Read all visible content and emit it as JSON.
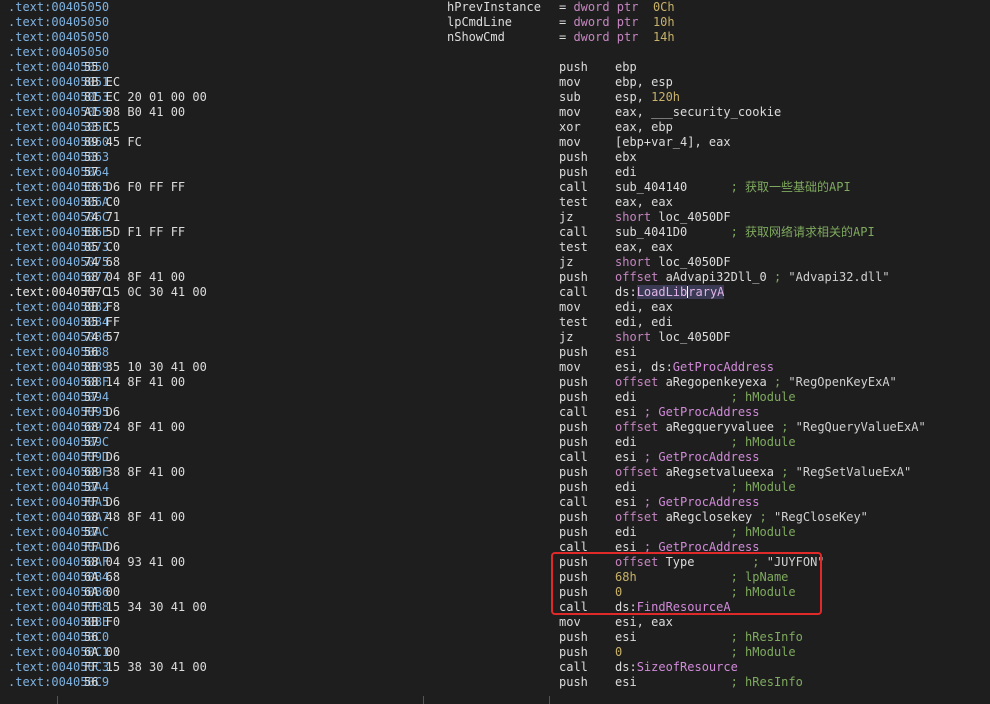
{
  "rows": [
    {
      "addr": ".text:00405050",
      "bytes": "",
      "arg_name": "hPrevInstance",
      "arg_def": [
        {
          "t": "= "
        },
        {
          "t": "dword ptr",
          "c": "kw"
        },
        {
          "t": "  "
        },
        {
          "t": "0Ch",
          "c": "num"
        }
      ]
    },
    {
      "addr": ".text:00405050",
      "bytes": "",
      "arg_name": "lpCmdLine",
      "arg_def": [
        {
          "t": "= "
        },
        {
          "t": "dword ptr",
          "c": "kw"
        },
        {
          "t": "  "
        },
        {
          "t": "10h",
          "c": "num"
        }
      ]
    },
    {
      "addr": ".text:00405050",
      "bytes": "",
      "arg_name": "nShowCmd",
      "arg_def": [
        {
          "t": "= "
        },
        {
          "t": "dword ptr",
          "c": "kw"
        },
        {
          "t": "  "
        },
        {
          "t": "14h",
          "c": "num"
        }
      ]
    },
    {
      "addr": ".text:00405050",
      "bytes": ""
    },
    {
      "addr": ".text:00405050",
      "bytes": "55",
      "mn": "push",
      "ops": [
        {
          "t": "ebp"
        }
      ]
    },
    {
      "addr": ".text:00405051",
      "bytes": "8B EC",
      "mn": "mov",
      "ops": [
        {
          "t": "ebp, esp"
        }
      ]
    },
    {
      "addr": ".text:00405053",
      "bytes": "81 EC 20 01 00 00",
      "mn": "sub",
      "ops": [
        {
          "t": "esp, "
        },
        {
          "t": "120h",
          "c": "num"
        }
      ]
    },
    {
      "addr": ".text:00405059",
      "bytes": "A1 08 B0 41 00",
      "mn": "mov",
      "ops": [
        {
          "t": "eax, ___security_cookie"
        }
      ]
    },
    {
      "addr": ".text:0040505E",
      "bytes": "33 C5",
      "mn": "xor",
      "ops": [
        {
          "t": "eax, ebp"
        }
      ]
    },
    {
      "addr": ".text:00405060",
      "bytes": "89 45 FC",
      "mn": "mov",
      "ops": [
        {
          "t": "[ebp+var_4], eax"
        }
      ]
    },
    {
      "addr": ".text:00405063",
      "bytes": "53",
      "mn": "push",
      "ops": [
        {
          "t": "ebx"
        }
      ]
    },
    {
      "addr": ".text:00405064",
      "bytes": "57",
      "mn": "push",
      "ops": [
        {
          "t": "edi"
        }
      ]
    },
    {
      "addr": ".text:00405065",
      "bytes": "E8 D6 F0 FF FF",
      "mn": "call",
      "ops": [
        {
          "t": "sub_404140      "
        },
        {
          "t": "; 获取一些基础的API",
          "c": "cmt"
        }
      ]
    },
    {
      "addr": ".text:0040506A",
      "bytes": "85 C0",
      "mn": "test",
      "ops": [
        {
          "t": "eax, eax"
        }
      ]
    },
    {
      "addr": ".text:0040506C",
      "bytes": "74 71",
      "mn": "jz",
      "ops": [
        {
          "t": "short",
          "c": "kw"
        },
        {
          "t": " loc_4050DF"
        }
      ]
    },
    {
      "addr": ".text:0040506E",
      "bytes": "E8 5D F1 FF FF",
      "mn": "call",
      "ops": [
        {
          "t": "sub_4041D0      "
        },
        {
          "t": "; 获取网络请求相关的API",
          "c": "cmt"
        }
      ]
    },
    {
      "addr": ".text:00405073",
      "bytes": "85 C0",
      "mn": "test",
      "ops": [
        {
          "t": "eax, eax"
        }
      ]
    },
    {
      "addr": ".text:00405075",
      "bytes": "74 68",
      "mn": "jz",
      "ops": [
        {
          "t": "short",
          "c": "kw"
        },
        {
          "t": " loc_4050DF"
        }
      ]
    },
    {
      "addr": ".text:00405077",
      "bytes": "68 04 8F 41 00",
      "mn": "push",
      "ops": [
        {
          "t": "offset",
          "c": "kw"
        },
        {
          "t": " aAdvapi32Dll_0 "
        },
        {
          "t": "; ",
          "c": "cmt"
        },
        {
          "t": "\"Advapi32.dll\"",
          "c": "str"
        }
      ]
    },
    {
      "addr": ".text:0040507C",
      "bytes": "FF 15 0C 30 41 00",
      "mn": "call",
      "cur": true,
      "ops": [
        {
          "t": "ds:"
        },
        {
          "t": "LoadLib",
          "c": "hl"
        },
        {
          "caret": true
        },
        {
          "t": "raryA",
          "c": "hl"
        }
      ]
    },
    {
      "addr": ".text:00405082",
      "bytes": "8B F8",
      "mn": "mov",
      "ops": [
        {
          "t": "edi, eax"
        }
      ]
    },
    {
      "addr": ".text:00405084",
      "bytes": "85 FF",
      "mn": "test",
      "ops": [
        {
          "t": "edi, edi"
        }
      ]
    },
    {
      "addr": ".text:00405086",
      "bytes": "74 57",
      "mn": "jz",
      "ops": [
        {
          "t": "short",
          "c": "kw"
        },
        {
          "t": " loc_4050DF"
        }
      ]
    },
    {
      "addr": ".text:00405088",
      "bytes": "56",
      "mn": "push",
      "ops": [
        {
          "t": "esi"
        }
      ]
    },
    {
      "addr": ".text:00405089",
      "bytes": "8B 35 10 30 41 00",
      "mn": "mov",
      "ops": [
        {
          "t": "esi, ds:"
        },
        {
          "t": "GetProcAddress",
          "c": "fn"
        }
      ]
    },
    {
      "addr": ".text:0040508F",
      "bytes": "68 14 8F 41 00",
      "mn": "push",
      "ops": [
        {
          "t": "offset",
          "c": "kw"
        },
        {
          "t": " aRegopenkeyexa "
        },
        {
          "t": "; ",
          "c": "cmt"
        },
        {
          "t": "\"RegOpenKeyExA\"",
          "c": "str"
        }
      ]
    },
    {
      "addr": ".text:00405094",
      "bytes": "57",
      "mn": "push",
      "ops": [
        {
          "t": "edi             "
        },
        {
          "t": "; hModule",
          "c": "cmt"
        }
      ]
    },
    {
      "addr": ".text:00405095",
      "bytes": "FF D6",
      "mn": "call",
      "ops": [
        {
          "t": "esi "
        },
        {
          "t": "; GetProcAddress",
          "c": "fn"
        }
      ]
    },
    {
      "addr": ".text:00405097",
      "bytes": "68 24 8F 41 00",
      "mn": "push",
      "ops": [
        {
          "t": "offset",
          "c": "kw"
        },
        {
          "t": " aRegqueryvaluee "
        },
        {
          "t": "; ",
          "c": "cmt"
        },
        {
          "t": "\"RegQueryValueExA\"",
          "c": "str"
        }
      ]
    },
    {
      "addr": ".text:0040509C",
      "bytes": "57",
      "mn": "push",
      "ops": [
        {
          "t": "edi             "
        },
        {
          "t": "; hModule",
          "c": "cmt"
        }
      ]
    },
    {
      "addr": ".text:0040509D",
      "bytes": "FF D6",
      "mn": "call",
      "ops": [
        {
          "t": "esi "
        },
        {
          "t": "; GetProcAddress",
          "c": "fn"
        }
      ]
    },
    {
      "addr": ".text:0040509F",
      "bytes": "68 38 8F 41 00",
      "mn": "push",
      "ops": [
        {
          "t": "offset",
          "c": "kw"
        },
        {
          "t": " aRegsetvalueexa "
        },
        {
          "t": "; ",
          "c": "cmt"
        },
        {
          "t": "\"RegSetValueExA\"",
          "c": "str"
        }
      ]
    },
    {
      "addr": ".text:004050A4",
      "bytes": "57",
      "mn": "push",
      "ops": [
        {
          "t": "edi             "
        },
        {
          "t": "; hModule",
          "c": "cmt"
        }
      ]
    },
    {
      "addr": ".text:004050A5",
      "bytes": "FF D6",
      "mn": "call",
      "ops": [
        {
          "t": "esi "
        },
        {
          "t": "; GetProcAddress",
          "c": "fn"
        }
      ]
    },
    {
      "addr": ".text:004050A7",
      "bytes": "68 48 8F 41 00",
      "mn": "push",
      "ops": [
        {
          "t": "offset",
          "c": "kw"
        },
        {
          "t": " aRegclosekey "
        },
        {
          "t": "; ",
          "c": "cmt"
        },
        {
          "t": "\"RegCloseKey\"",
          "c": "str"
        }
      ]
    },
    {
      "addr": ".text:004050AC",
      "bytes": "57",
      "mn": "push",
      "ops": [
        {
          "t": "edi             "
        },
        {
          "t": "; hModule",
          "c": "cmt"
        }
      ]
    },
    {
      "addr": ".text:004050AD",
      "bytes": "FF D6",
      "mn": "call",
      "ops": [
        {
          "t": "esi "
        },
        {
          "t": "; GetProcAddress",
          "c": "fn"
        }
      ]
    },
    {
      "addr": ".text:004050AF",
      "bytes": "68 04 93 41 00",
      "mn": "push",
      "ops": [
        {
          "t": "offset",
          "c": "kw"
        },
        {
          "t": " Type        "
        },
        {
          "t": "; ",
          "c": "cmt"
        },
        {
          "t": "\"JUYFON\"",
          "c": "str"
        }
      ]
    },
    {
      "addr": ".text:004050B4",
      "bytes": "6A 68",
      "mn": "push",
      "ops": [
        {
          "t": "68h",
          "c": "num"
        },
        {
          "t": "             "
        },
        {
          "t": "; lpName",
          "c": "cmt"
        }
      ]
    },
    {
      "addr": ".text:004050B6",
      "bytes": "6A 00",
      "mn": "push",
      "ops": [
        {
          "t": "0",
          "c": "num"
        },
        {
          "t": "               "
        },
        {
          "t": "; hModule",
          "c": "cmt"
        }
      ]
    },
    {
      "addr": ".text:004050B8",
      "bytes": "FF 15 34 30 41 00",
      "mn": "call",
      "ops": [
        {
          "t": "ds:"
        },
        {
          "t": "FindResourceA",
          "c": "fn"
        }
      ]
    },
    {
      "addr": ".text:004050BE",
      "bytes": "8B F0",
      "mn": "mov",
      "ops": [
        {
          "t": "esi, eax"
        }
      ]
    },
    {
      "addr": ".text:004050C0",
      "bytes": "56",
      "mn": "push",
      "ops": [
        {
          "t": "esi             "
        },
        {
          "t": "; hResInfo",
          "c": "cmt"
        }
      ]
    },
    {
      "addr": ".text:004050C1",
      "bytes": "6A 00",
      "mn": "push",
      "ops": [
        {
          "t": "0",
          "c": "num"
        },
        {
          "t": "               "
        },
        {
          "t": "; hModule",
          "c": "cmt"
        }
      ]
    },
    {
      "addr": ".text:004050C3",
      "bytes": "FF 15 38 30 41 00",
      "mn": "call",
      "ops": [
        {
          "t": "ds:"
        },
        {
          "t": "SizeofResource",
          "c": "fn"
        }
      ]
    },
    {
      "addr": ".text:004050C9",
      "bytes": "56",
      "mn": "push",
      "ops": [
        {
          "t": "esi             "
        },
        {
          "t": "; hResInfo",
          "c": "cmt"
        }
      ]
    }
  ],
  "colors": {
    "background": "#1e1e1e",
    "address": "#7fb2e0",
    "comment": "#7faa5f",
    "keyword": "#c586c0",
    "function": "#d08ad8",
    "number": "#c8b26a",
    "annotation_box": "#e02a2a"
  }
}
